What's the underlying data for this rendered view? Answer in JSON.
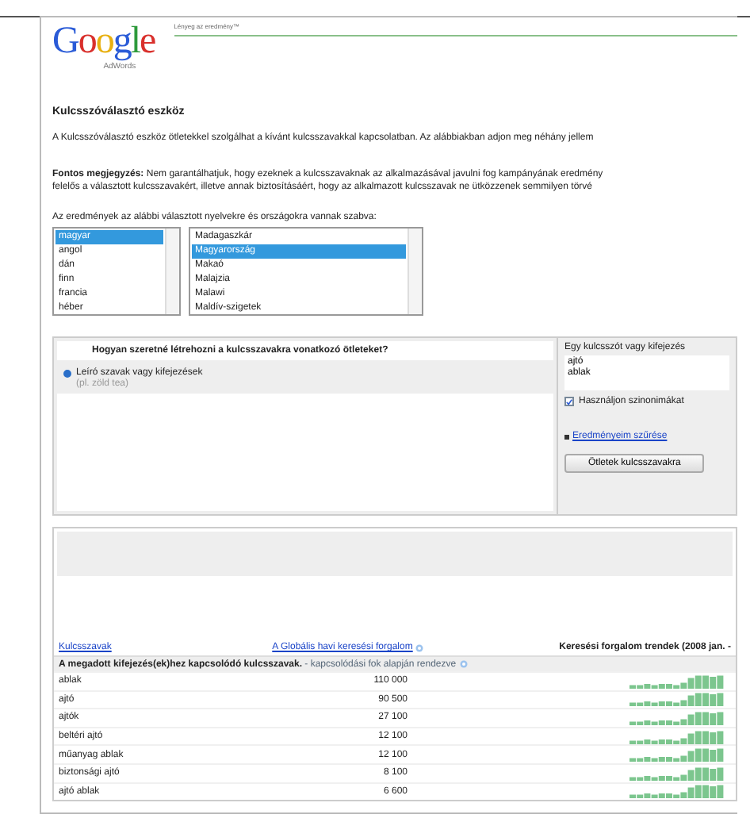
{
  "header": {
    "logo": "Google",
    "logo_sub": "AdWords",
    "slogan": "Lényeg az eredmény™"
  },
  "title": "Kulcsszóválasztó eszköz",
  "intro": "A Kulcsszóválasztó eszköz ötletekkel szolgálhat a kívánt kulcsszavakkal kapcsolatban. Az alábbiakban adjon meg néhány jellem",
  "note_lines": [
    "**Fontos megjegyzés:** Nem garantálhatjuk, hogy ezeknek a kulcsszavaknak az alkalmazásával javulni fog kampányának eredmény",
    "felelős a választott kulcsszavakért, illetve annak biztosításáért, hogy az alkalmazott kulcsszavak ne ütközzenek semmilyen törvé"
  ],
  "filters": {
    "label": "Az eredmények az alábbi választott nyelvekre és országokra vannak szabva:",
    "languages": [
      {
        "label": "magyar",
        "selected": true
      },
      {
        "label": "angol",
        "selected": false
      },
      {
        "label": "dán",
        "selected": false
      },
      {
        "label": "finn",
        "selected": false
      },
      {
        "label": "francia",
        "selected": false
      },
      {
        "label": "héber",
        "selected": false
      }
    ],
    "countries": [
      {
        "label": "Madagaszkár",
        "selected": false
      },
      {
        "label": "Magyarország",
        "selected": true
      },
      {
        "label": "Makaó",
        "selected": false
      },
      {
        "label": "Malajzia",
        "selected": false
      },
      {
        "label": "Malawi",
        "selected": false
      },
      {
        "label": "Maldív-szigetek",
        "selected": false
      }
    ]
  },
  "ideas": {
    "question": "Hogyan szeretné létrehozni a kulcsszavakra vonatkozó ötleteket?",
    "options": [
      {
        "label": "Leíró szavak vagy kifejezések",
        "hint": "(pl. zöld tea)",
        "selected": true
      }
    ],
    "input_label": "Egy kulcsszót vagy kifejezés",
    "input_value": "ajtó\nablak",
    "synonyms": {
      "label": "Használjon szinonimákat",
      "checked": true
    },
    "filter_link": "Eredményeim szűrése",
    "button": "Ötletek kulcsszavakra"
  },
  "results": {
    "columns": [
      {
        "label": "Kulcsszavak",
        "help": false,
        "kind": "link"
      },
      {
        "label": "A Globális havi keresési forgalom",
        "help": true,
        "kind": "link"
      },
      {
        "label": "Keresési forgalom trendek (2008 jan. -",
        "help": false,
        "kind": "plain"
      }
    ],
    "group": {
      "title": "**A megadott kifejezés(ek)hez kapcsolódó kulcsszavak.** - kapcsolódási fok alapján rendezve",
      "help": true
    },
    "rows": [
      {
        "keyword": "ablak",
        "volume": "110 000"
      },
      {
        "keyword": "ajtó",
        "volume": "90 500"
      },
      {
        "keyword": "ajtók",
        "volume": "27 100"
      },
      {
        "keyword": "beltéri ajtó",
        "volume": "12 100"
      },
      {
        "keyword": "műanyag ablak",
        "volume": "12 100"
      },
      {
        "keyword": "biztonsági ajtó",
        "volume": "8 100"
      },
      {
        "keyword": "ajtó ablak",
        "volume": "6 600"
      }
    ]
  }
}
